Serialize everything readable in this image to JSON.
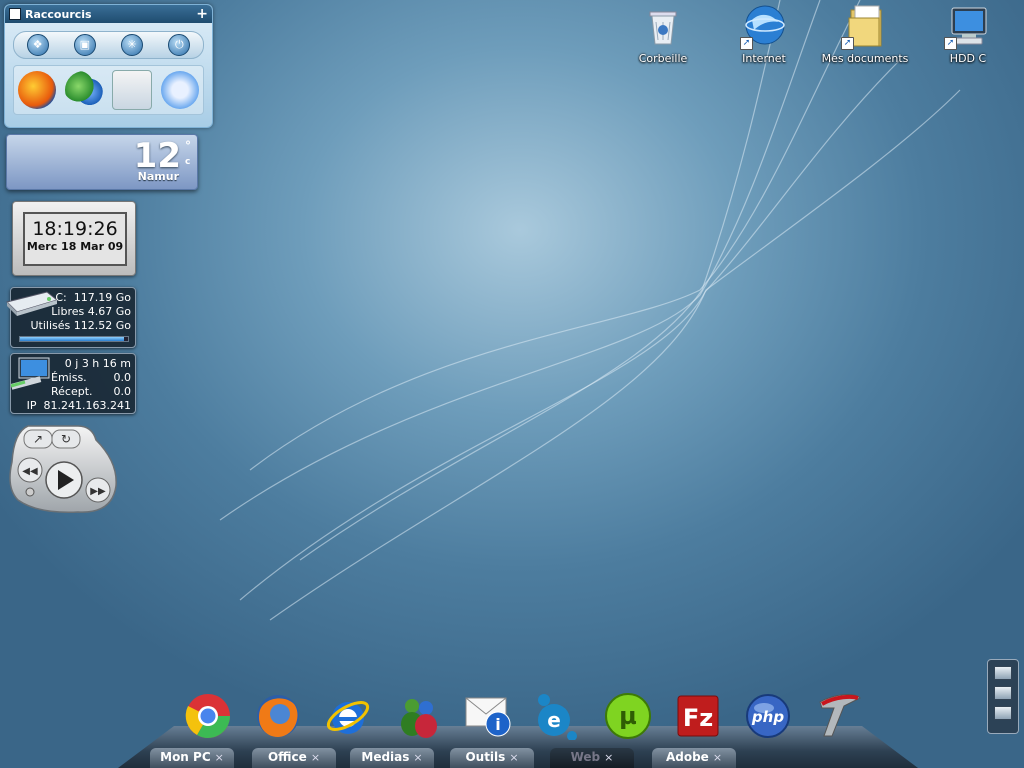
{
  "desktop_icons": [
    {
      "name": "trash-icon",
      "label": "Corbeille"
    },
    {
      "name": "internet-icon",
      "label": "Internet"
    },
    {
      "name": "documents-icon",
      "label": "Mes documents"
    },
    {
      "name": "computer-icon",
      "label": "HDD C"
    }
  ],
  "shortcuts": {
    "title": "Raccourcis",
    "add_glyph": "+"
  },
  "weather": {
    "temperature": "12",
    "degree": "°",
    "unit": "c",
    "city": "Namur"
  },
  "clock": {
    "time": "18:19:26",
    "date": "Merc 18 Mar 09"
  },
  "disk": {
    "drive": "C:",
    "total": "117.19 Go",
    "free_label": "Libres",
    "free": "4.67 Go",
    "used_label": "Utilisés",
    "used": "112.52 Go",
    "used_fraction": 0.96
  },
  "network": {
    "uptime": "0 j 3 h 16 m",
    "sent_label": "Émiss.",
    "sent": "0.0",
    "recv_label": "Récept.",
    "recv": "0.0",
    "ip_label": "IP",
    "ip": "81.241.163.241"
  },
  "dock": {
    "apps": [
      "chrome-icon",
      "firefox-icon",
      "ie-icon",
      "messenger-icon",
      "mail-icon",
      "emule-icon",
      "utorrent-icon",
      "filezilla-icon",
      "php-icon",
      "teamspeak-icon"
    ],
    "tabs": [
      {
        "label": "Mon PC",
        "close": "×",
        "active": false
      },
      {
        "label": "Office",
        "close": "×",
        "active": false
      },
      {
        "label": "Medias",
        "close": "×",
        "active": false
      },
      {
        "label": "Outils",
        "close": "×",
        "active": false
      },
      {
        "label": "Web",
        "close": "×",
        "active": true
      },
      {
        "label": "Adobe",
        "close": "×",
        "active": false
      }
    ]
  },
  "colors": {
    "wallpaper": "#4d7d9f",
    "accent": "#2a7fd0"
  }
}
